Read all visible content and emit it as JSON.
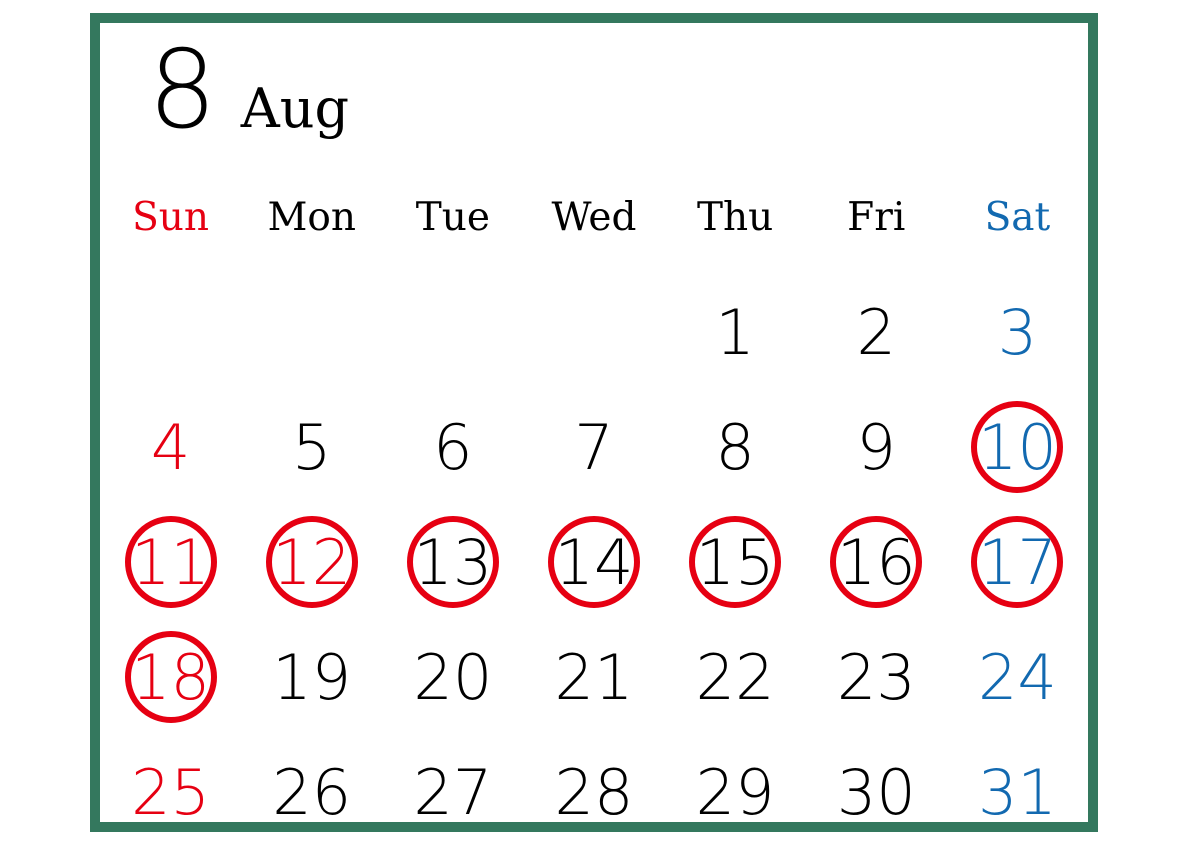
{
  "calendar": {
    "month_number": "8",
    "month_name": "Aug",
    "colors": {
      "frame": "#34785E",
      "sunday": "#E60012",
      "saturday": "#1269B0",
      "weekday": "#000000",
      "circle": "#E60012",
      "background": "#FFFFFF"
    },
    "weekdays": [
      {
        "label": "Sun",
        "color": "#E60012"
      },
      {
        "label": "Mon",
        "color": "#000000"
      },
      {
        "label": "Tue",
        "color": "#000000"
      },
      {
        "label": "Wed",
        "color": "#000000"
      },
      {
        "label": "Thu",
        "color": "#000000"
      },
      {
        "label": "Fri",
        "color": "#000000"
      },
      {
        "label": "Sat",
        "color": "#1269B0"
      }
    ],
    "weeks": [
      [
        {
          "day": "",
          "color": "#000000",
          "circled": false
        },
        {
          "day": "",
          "color": "#000000",
          "circled": false
        },
        {
          "day": "",
          "color": "#000000",
          "circled": false
        },
        {
          "day": "",
          "color": "#000000",
          "circled": false
        },
        {
          "day": "1",
          "color": "#000000",
          "circled": false
        },
        {
          "day": "2",
          "color": "#000000",
          "circled": false
        },
        {
          "day": "3",
          "color": "#1269B0",
          "circled": false
        }
      ],
      [
        {
          "day": "4",
          "color": "#E60012",
          "circled": false
        },
        {
          "day": "5",
          "color": "#000000",
          "circled": false
        },
        {
          "day": "6",
          "color": "#000000",
          "circled": false
        },
        {
          "day": "7",
          "color": "#000000",
          "circled": false
        },
        {
          "day": "8",
          "color": "#000000",
          "circled": false
        },
        {
          "day": "9",
          "color": "#000000",
          "circled": false
        },
        {
          "day": "10",
          "color": "#1269B0",
          "circled": true
        }
      ],
      [
        {
          "day": "11",
          "color": "#E60012",
          "circled": true
        },
        {
          "day": "12",
          "color": "#E60012",
          "circled": true
        },
        {
          "day": "13",
          "color": "#000000",
          "circled": true
        },
        {
          "day": "14",
          "color": "#000000",
          "circled": true
        },
        {
          "day": "15",
          "color": "#000000",
          "circled": true
        },
        {
          "day": "16",
          "color": "#000000",
          "circled": true
        },
        {
          "day": "17",
          "color": "#1269B0",
          "circled": true
        }
      ],
      [
        {
          "day": "18",
          "color": "#E60012",
          "circled": true
        },
        {
          "day": "19",
          "color": "#000000",
          "circled": false
        },
        {
          "day": "20",
          "color": "#000000",
          "circled": false
        },
        {
          "day": "21",
          "color": "#000000",
          "circled": false
        },
        {
          "day": "22",
          "color": "#000000",
          "circled": false
        },
        {
          "day": "23",
          "color": "#000000",
          "circled": false
        },
        {
          "day": "24",
          "color": "#1269B0",
          "circled": false
        }
      ],
      [
        {
          "day": "25",
          "color": "#E60012",
          "circled": false
        },
        {
          "day": "26",
          "color": "#000000",
          "circled": false
        },
        {
          "day": "27",
          "color": "#000000",
          "circled": false
        },
        {
          "day": "28",
          "color": "#000000",
          "circled": false
        },
        {
          "day": "29",
          "color": "#000000",
          "circled": false
        },
        {
          "day": "30",
          "color": "#000000",
          "circled": false
        },
        {
          "day": "31",
          "color": "#1269B0",
          "circled": false
        }
      ]
    ]
  }
}
